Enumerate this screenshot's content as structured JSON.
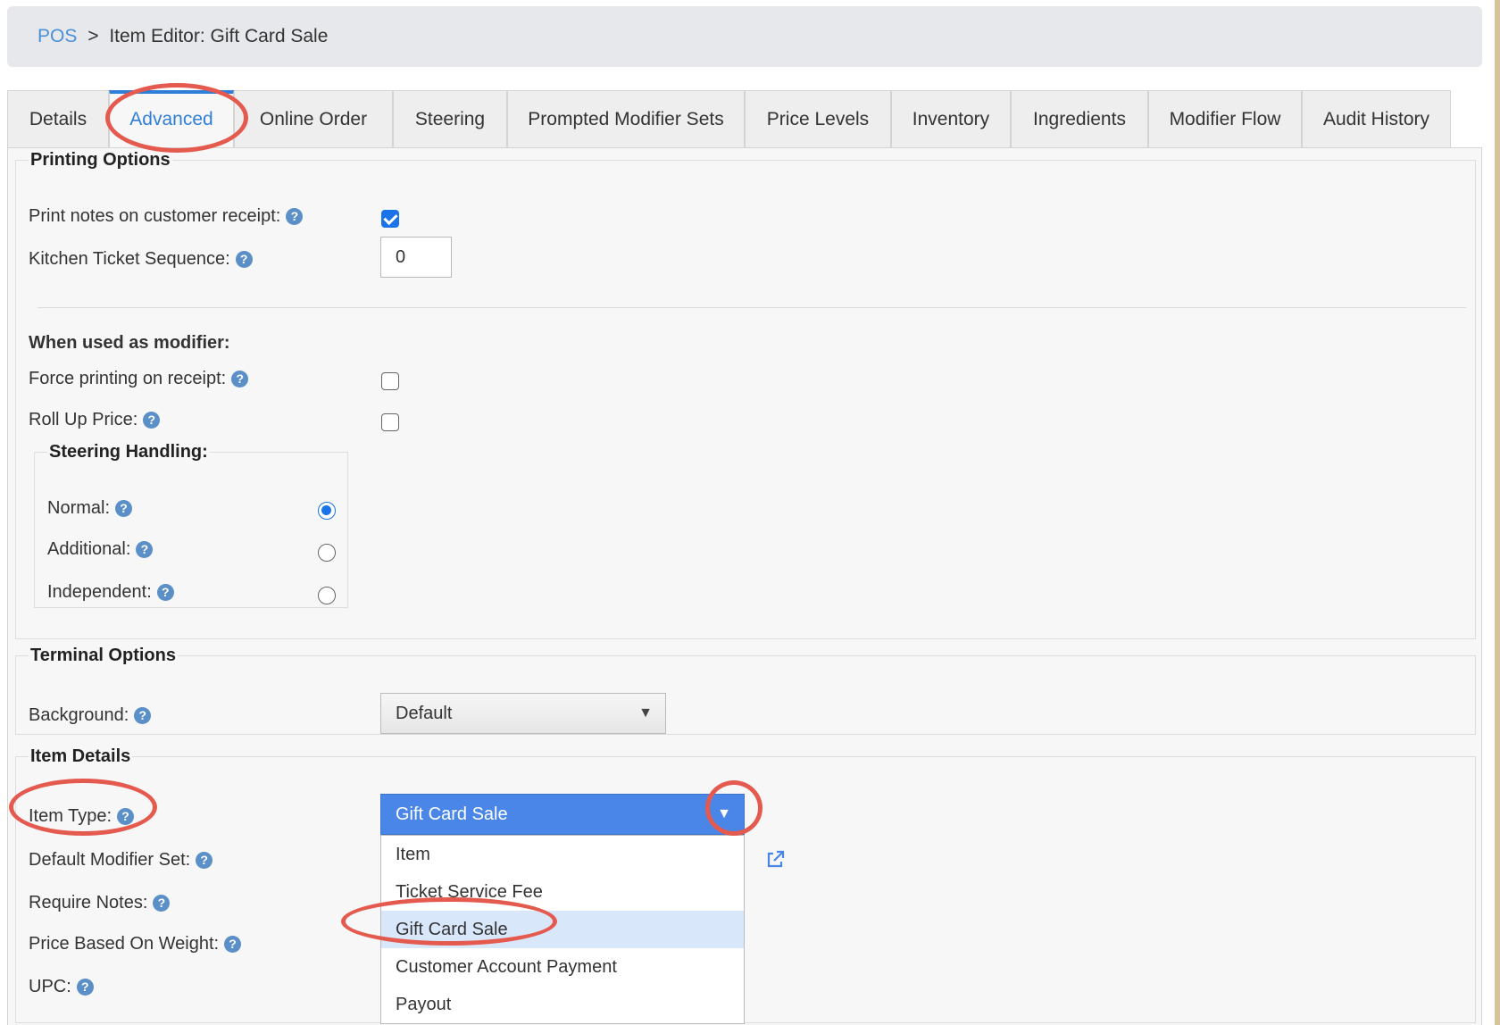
{
  "breadcrumb": {
    "root": "POS",
    "separator": ">",
    "current": "Item Editor: Gift Card Sale"
  },
  "tabs": [
    {
      "label": "Details",
      "active": false
    },
    {
      "label": "Advanced",
      "active": true
    },
    {
      "label": "Online Order",
      "active": false
    },
    {
      "label": "Steering",
      "active": false
    },
    {
      "label": "Prompted Modifier Sets",
      "active": false
    },
    {
      "label": "Price Levels",
      "active": false
    },
    {
      "label": "Inventory",
      "active": false
    },
    {
      "label": "Ingredients",
      "active": false
    },
    {
      "label": "Modifier Flow",
      "active": false
    },
    {
      "label": "Audit History",
      "active": false
    }
  ],
  "printing_options": {
    "legend": "Printing Options",
    "print_notes_label": "Print notes on customer receipt:",
    "print_notes_checked": true,
    "kitchen_seq_label": "Kitchen Ticket Sequence:",
    "kitchen_seq_value": "0",
    "modifier_heading": "When used as modifier:",
    "force_printing_label": "Force printing on receipt:",
    "force_printing_checked": false,
    "roll_up_label": "Roll Up Price:",
    "roll_up_checked": false,
    "steering": {
      "legend": "Steering Handling:",
      "normal_label": "Normal:",
      "additional_label": "Additional:",
      "independent_label": "Independent:",
      "selected": "Normal"
    }
  },
  "terminal_options": {
    "legend": "Terminal Options",
    "background_label": "Background:",
    "background_value": "Default"
  },
  "item_details": {
    "legend": "Item Details",
    "item_type_label": "Item Type:",
    "item_type_value": "Gift Card Sale",
    "item_type_options": [
      "Item",
      "Ticket Service Fee",
      "Gift Card Sale",
      "Customer Account Payment",
      "Payout"
    ],
    "highlighted_option": "Gift Card Sale",
    "default_modifier_label": "Default Modifier Set:",
    "require_notes_label": "Require Notes:",
    "price_weight_label": "Price Based On Weight:",
    "upc_label": "UPC:"
  },
  "icons": {
    "help": "question-circle-icon",
    "dropdown": "caret-down-icon",
    "external": "external-link-icon"
  },
  "colors": {
    "accent": "#2f7fd8",
    "annotation_ring": "#e55a4e",
    "selected_select_bg": "#4a86e8",
    "highlight_option_bg": "#d9e7fb"
  }
}
